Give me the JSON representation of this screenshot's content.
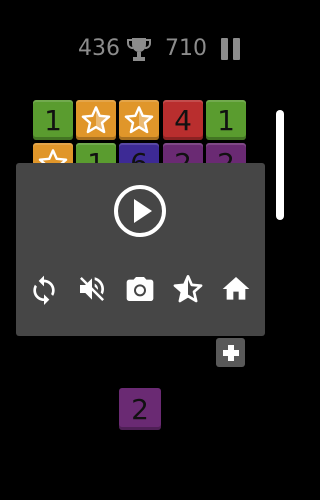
{
  "header": {
    "score_current": "436",
    "score_best": "710",
    "trophy_icon": "trophy-icon",
    "pause_icon": "pause-icon"
  },
  "board": {
    "colors": {
      "green": "#5a9c2f",
      "orange": "#e0962a",
      "red": "#b92e2e",
      "purple": "#6a2a73",
      "indigo": "#3d2a95"
    },
    "row1": [
      {
        "value": "1",
        "color": "#5a9c2f"
      },
      {
        "value": "",
        "color": "#e0962a",
        "icon": "star-icon"
      },
      {
        "value": "",
        "color": "#e0962a",
        "icon": "star-icon"
      },
      {
        "value": "4",
        "color": "#b92e2e"
      },
      {
        "value": "1",
        "color": "#5a9c2f"
      }
    ],
    "row2_partial": [
      {
        "value": "",
        "color": "#e0962a",
        "icon": "star-icon"
      },
      {
        "value": "1",
        "color": "#5a9c2f"
      },
      {
        "value": "6",
        "color": "#3d2a95"
      },
      {
        "value": "2",
        "color": "#6a2a73"
      },
      {
        "value": "2",
        "color": "#6a2a73"
      }
    ]
  },
  "overlay": {
    "play_icon": "play-icon",
    "actions": [
      "restart-icon",
      "mute-icon",
      "camera-icon",
      "star-rate-icon",
      "home-icon"
    ]
  },
  "plus_button_icon": "plus-icon",
  "next_tile": {
    "value": "2",
    "color": "#6a2a73"
  }
}
